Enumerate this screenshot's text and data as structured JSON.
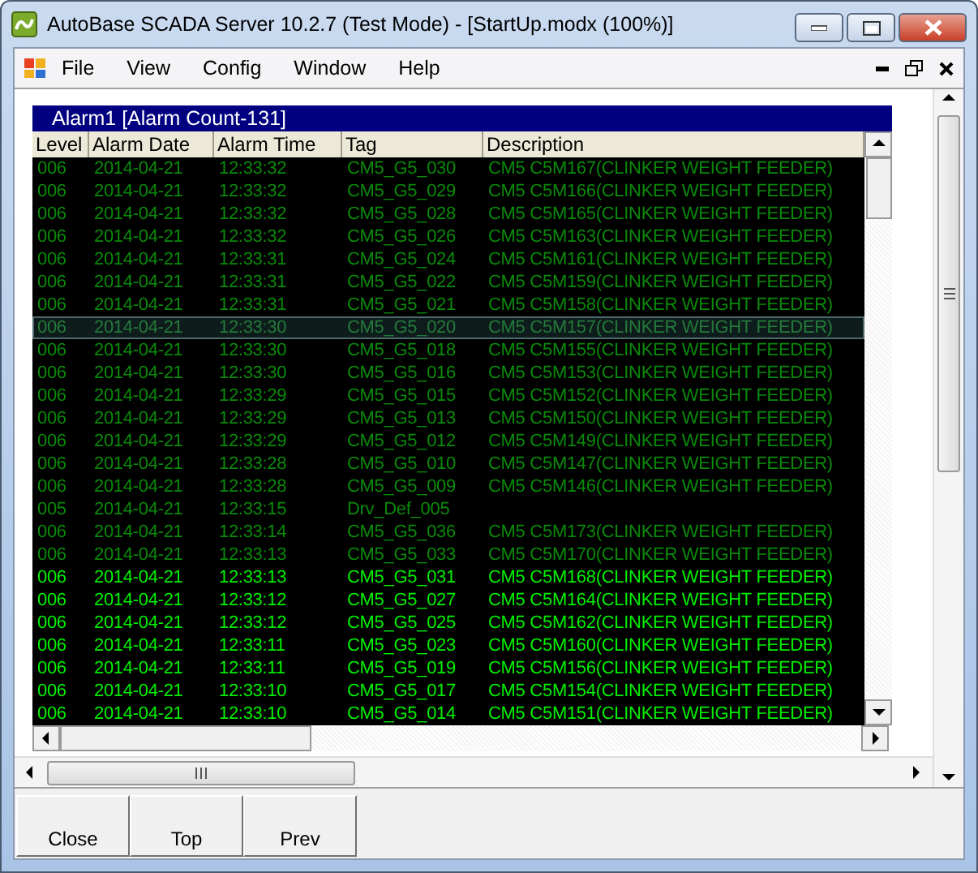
{
  "window": {
    "title": "AutoBase SCADA Server 10.2.7 (Test Mode) - [StartUp.modx (100%)]"
  },
  "menu": [
    "File",
    "View",
    "Config",
    "Window",
    "Help"
  ],
  "alarm_panel": {
    "title": "Alarm1 [Alarm Count-131]",
    "columns": [
      "Level",
      "Alarm Date",
      "Alarm Time",
      "Tag",
      "Description"
    ],
    "rows": [
      {
        "level": "006",
        "date": "2014-04-21",
        "time": "12:33:32",
        "tag": "CM5_G5_030",
        "description": "CM5 C5M167(CLINKER WEIGHT FEEDER)",
        "acknowledged": true,
        "selected": false
      },
      {
        "level": "006",
        "date": "2014-04-21",
        "time": "12:33:32",
        "tag": "CM5_G5_029",
        "description": "CM5 C5M166(CLINKER WEIGHT FEEDER)",
        "acknowledged": true,
        "selected": false
      },
      {
        "level": "006",
        "date": "2014-04-21",
        "time": "12:33:32",
        "tag": "CM5_G5_028",
        "description": "CM5 C5M165(CLINKER WEIGHT FEEDER)",
        "acknowledged": true,
        "selected": false
      },
      {
        "level": "006",
        "date": "2014-04-21",
        "time": "12:33:32",
        "tag": "CM5_G5_026",
        "description": "CM5 C5M163(CLINKER WEIGHT FEEDER)",
        "acknowledged": true,
        "selected": false
      },
      {
        "level": "006",
        "date": "2014-04-21",
        "time": "12:33:31",
        "tag": "CM5_G5_024",
        "description": "CM5 C5M161(CLINKER WEIGHT FEEDER)",
        "acknowledged": true,
        "selected": false
      },
      {
        "level": "006",
        "date": "2014-04-21",
        "time": "12:33:31",
        "tag": "CM5_G5_022",
        "description": "CM5 C5M159(CLINKER WEIGHT FEEDER)",
        "acknowledged": true,
        "selected": false
      },
      {
        "level": "006",
        "date": "2014-04-21",
        "time": "12:33:31",
        "tag": "CM5_G5_021",
        "description": "CM5 C5M158(CLINKER WEIGHT FEEDER)",
        "acknowledged": true,
        "selected": false
      },
      {
        "level": "006",
        "date": "2014-04-21",
        "time": "12:33:30",
        "tag": "CM5_G5_020",
        "description": "CM5 C5M157(CLINKER WEIGHT FEEDER)",
        "acknowledged": true,
        "selected": true
      },
      {
        "level": "006",
        "date": "2014-04-21",
        "time": "12:33:30",
        "tag": "CM5_G5_018",
        "description": "CM5 C5M155(CLINKER WEIGHT FEEDER)",
        "acknowledged": true,
        "selected": false
      },
      {
        "level": "006",
        "date": "2014-04-21",
        "time": "12:33:30",
        "tag": "CM5_G5_016",
        "description": "CM5 C5M153(CLINKER WEIGHT FEEDER)",
        "acknowledged": true,
        "selected": false
      },
      {
        "level": "006",
        "date": "2014-04-21",
        "time": "12:33:29",
        "tag": "CM5_G5_015",
        "description": "CM5 C5M152(CLINKER WEIGHT FEEDER)",
        "acknowledged": true,
        "selected": false
      },
      {
        "level": "006",
        "date": "2014-04-21",
        "time": "12:33:29",
        "tag": "CM5_G5_013",
        "description": "CM5 C5M150(CLINKER WEIGHT FEEDER)",
        "acknowledged": true,
        "selected": false
      },
      {
        "level": "006",
        "date": "2014-04-21",
        "time": "12:33:29",
        "tag": "CM5_G5_012",
        "description": "CM5 C5M149(CLINKER WEIGHT FEEDER)",
        "acknowledged": true,
        "selected": false
      },
      {
        "level": "006",
        "date": "2014-04-21",
        "time": "12:33:28",
        "tag": "CM5_G5_010",
        "description": "CM5 C5M147(CLINKER WEIGHT FEEDER)",
        "acknowledged": true,
        "selected": false
      },
      {
        "level": "006",
        "date": "2014-04-21",
        "time": "12:33:28",
        "tag": "CM5_G5_009",
        "description": "CM5 C5M146(CLINKER WEIGHT FEEDER)",
        "acknowledged": true,
        "selected": false
      },
      {
        "level": "005",
        "date": "2014-04-21",
        "time": "12:33:15",
        "tag": "Drv_Def_005",
        "acknowledged": true,
        "selected": false
      },
      {
        "level": "006",
        "date": "2014-04-21",
        "time": "12:33:14",
        "tag": "CM5_G5_036",
        "description": "CM5 C5M173(CLINKER WEIGHT FEEDER)",
        "acknowledged": true,
        "selected": false
      },
      {
        "level": "006",
        "date": "2014-04-21",
        "time": "12:33:13",
        "tag": "CM5_G5_033",
        "description": "CM5 C5M170(CLINKER WEIGHT FEEDER)",
        "acknowledged": true,
        "selected": false
      },
      {
        "level": "006",
        "date": "2014-04-21",
        "time": "12:33:13",
        "tag": "CM5_G5_031",
        "description": "CM5 C5M168(CLINKER WEIGHT FEEDER)",
        "acknowledged": false,
        "selected": false
      },
      {
        "level": "006",
        "date": "2014-04-21",
        "time": "12:33:12",
        "tag": "CM5_G5_027",
        "description": "CM5 C5M164(CLINKER WEIGHT FEEDER)",
        "acknowledged": false,
        "selected": false
      },
      {
        "level": "006",
        "date": "2014-04-21",
        "time": "12:33:12",
        "tag": "CM5_G5_025",
        "description": "CM5 C5M162(CLINKER WEIGHT FEEDER)",
        "acknowledged": false,
        "selected": false
      },
      {
        "level": "006",
        "date": "2014-04-21",
        "time": "12:33:11",
        "tag": "CM5_G5_023",
        "description": "CM5 C5M160(CLINKER WEIGHT FEEDER)",
        "acknowledged": false,
        "selected": false
      },
      {
        "level": "006",
        "date": "2014-04-21",
        "time": "12:33:11",
        "tag": "CM5_G5_019",
        "description": "CM5 C5M156(CLINKER WEIGHT FEEDER)",
        "acknowledged": false,
        "selected": false
      },
      {
        "level": "006",
        "date": "2014-04-21",
        "time": "12:33:10",
        "tag": "CM5_G5_017",
        "description": "CM5 C5M154(CLINKER WEIGHT FEEDER)",
        "acknowledged": false,
        "selected": false
      },
      {
        "level": "006",
        "date": "2014-04-21",
        "time": "12:33:10",
        "tag": "CM5_G5_014",
        "description": "CM5 C5M151(CLINKER WEIGHT FEEDER)",
        "acknowledged": false,
        "selected": false
      }
    ]
  },
  "buttons": [
    "Close",
    "Top",
    "Prev"
  ]
}
